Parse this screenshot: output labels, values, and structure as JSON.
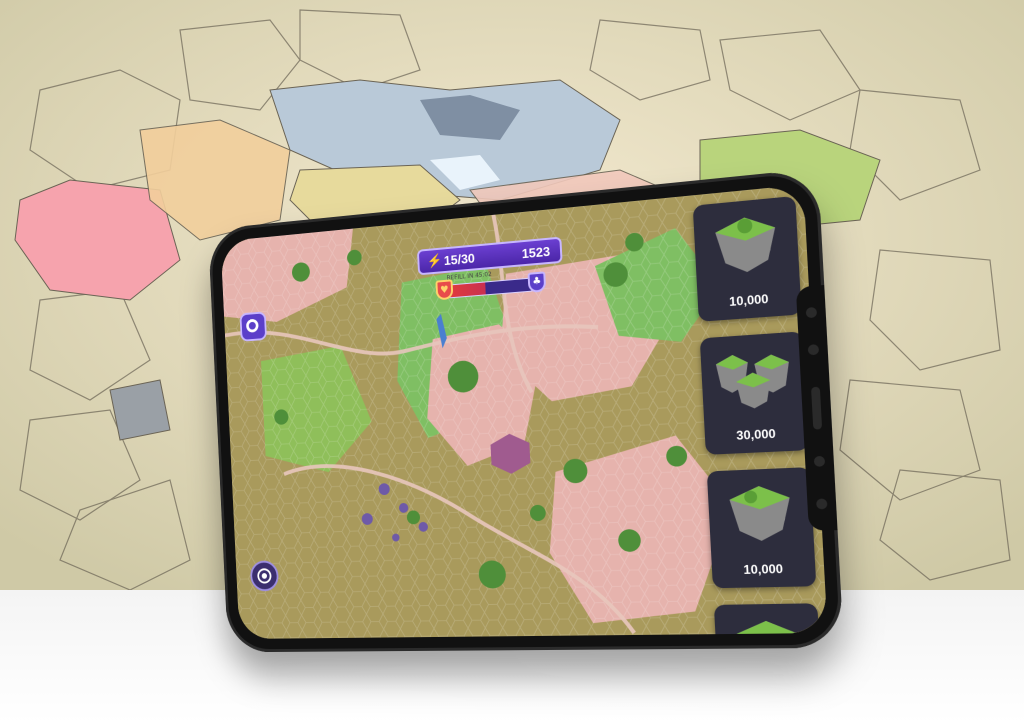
{
  "hud": {
    "energy": "15/30",
    "coins": "1523",
    "subtitle": "REFILL IN 45:02",
    "battle_progress": 0.45
  },
  "shop": {
    "items": [
      {
        "price": "10,000",
        "icon": "floating-island-icon"
      },
      {
        "price": "30,000",
        "icon": "floating-islands-cluster-icon"
      },
      {
        "price": "10,000",
        "icon": "floating-island-icon"
      },
      {
        "price": "",
        "icon": "floating-island-icon"
      }
    ]
  },
  "buttons": {
    "settings_icon": "settings-icon",
    "target_icon": "target-icon"
  },
  "colors": {
    "accent": "#5b3fc9",
    "map_grass": "#a99a5c",
    "map_pink": "#e6b3ad",
    "map_green": "#7fbf63"
  }
}
